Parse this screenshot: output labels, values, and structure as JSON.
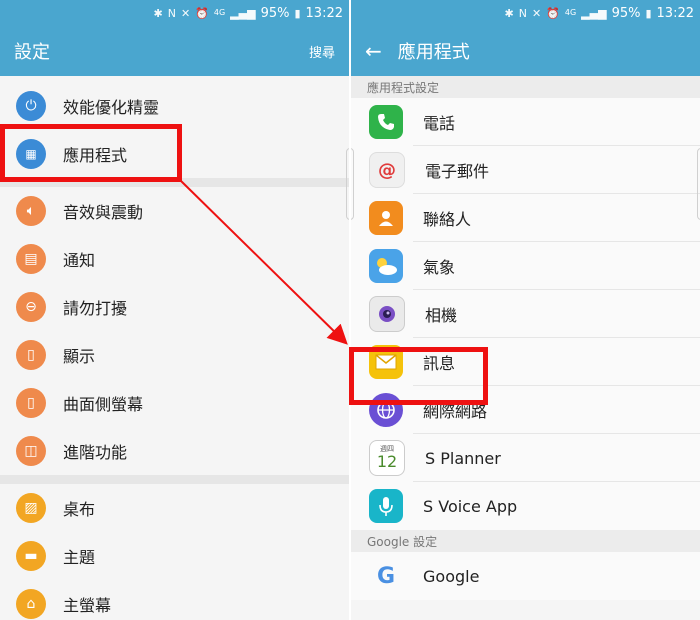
{
  "status": {
    "battery": "95%",
    "time": "13:22",
    "network": "4G"
  },
  "left": {
    "title": "設定",
    "search": "搜尋",
    "group1": [
      {
        "label": "效能優化精靈",
        "icon": "power-icon",
        "color": "#3b8bd6"
      },
      {
        "label": "應用程式",
        "icon": "apps-grid-icon",
        "color": "#3b8bd6"
      }
    ],
    "group2": [
      {
        "label": "音效與震動",
        "icon": "volume-icon",
        "color": "#ef8a4c"
      },
      {
        "label": "通知",
        "icon": "notification-icon",
        "color": "#ef8a4c"
      },
      {
        "label": "請勿打擾",
        "icon": "do-not-disturb-icon",
        "color": "#ef8a4c"
      },
      {
        "label": "顯示",
        "icon": "display-icon",
        "color": "#ef8a4c"
      },
      {
        "label": "曲面側螢幕",
        "icon": "edge-screen-icon",
        "color": "#ef8a4c"
      },
      {
        "label": "進階功能",
        "icon": "advanced-features-icon",
        "color": "#ef8a4c"
      }
    ],
    "group3": [
      {
        "label": "桌布",
        "icon": "wallpaper-icon",
        "color": "#f2a623"
      },
      {
        "label": "主題",
        "icon": "themes-icon",
        "color": "#f2a623"
      },
      {
        "label": "主螢幕",
        "icon": "home-icon",
        "color": "#f2a623"
      }
    ]
  },
  "right": {
    "title": "應用程式",
    "section1": "應用程式設定",
    "apps": [
      {
        "label": "電話",
        "icon": "phone-icon"
      },
      {
        "label": "電子郵件",
        "icon": "email-icon"
      },
      {
        "label": "聯絡人",
        "icon": "contacts-icon"
      },
      {
        "label": "氣象",
        "icon": "weather-icon"
      },
      {
        "label": "相機",
        "icon": "camera-icon"
      },
      {
        "label": "訊息",
        "icon": "messages-icon"
      },
      {
        "label": "網際網路",
        "icon": "internet-icon"
      },
      {
        "label": "S Planner",
        "icon": "calendar-icon"
      },
      {
        "label": "S Voice App",
        "icon": "s-voice-icon"
      }
    ],
    "planner_day": "週四",
    "planner_date": "12",
    "section2": "Google 設定",
    "google": {
      "label": "Google",
      "icon": "google-icon"
    }
  }
}
